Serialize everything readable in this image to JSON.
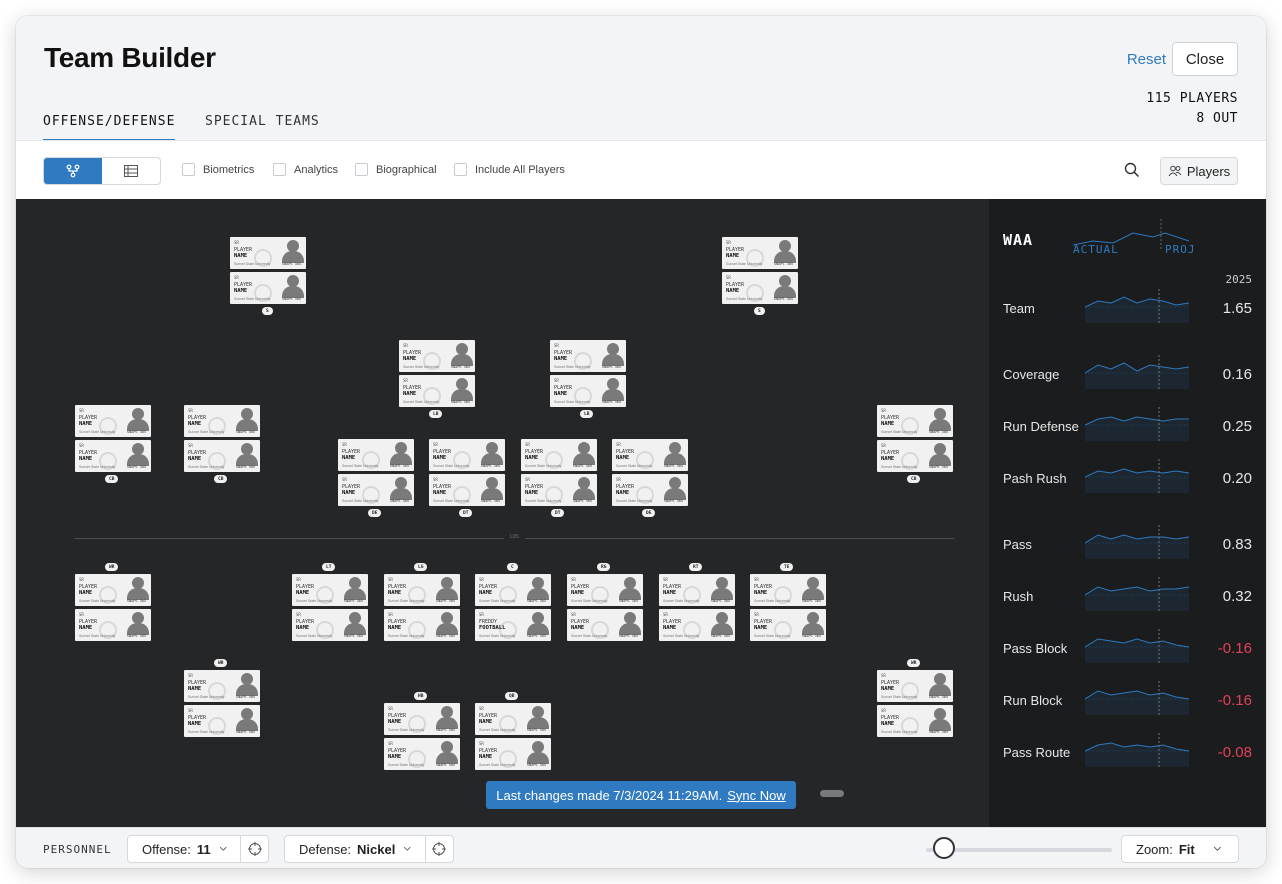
{
  "header": {
    "title": "Team Builder",
    "reset_label": "Reset",
    "close_label": "Close",
    "players_count": "115 PLAYERS",
    "out_count": "8 OUT"
  },
  "tabs": [
    {
      "label": "OFFENSE/DEFENSE",
      "active": true
    },
    {
      "label": "SPECIAL TEAMS",
      "active": false
    }
  ],
  "toolbar": {
    "view_modes": [
      "depth-chart-icon",
      "table-icon"
    ],
    "filters": [
      "Biometrics",
      "Analytics",
      "Biographical",
      "Include All Players"
    ],
    "players_button": "Players"
  },
  "card_template": {
    "position": "SR",
    "first_name": "PLAYER",
    "last_name": "NAME",
    "school": "Sunset State University",
    "snaps": "SNAPS 305"
  },
  "special_card": {
    "first_name": "FREDDY",
    "last_name": "FOOTBALL"
  },
  "field": {
    "los_label": "LOS",
    "position_labels": {
      "s1": "S",
      "s2": "S",
      "lb1": "LB",
      "lb2": "LB",
      "cb1": "CB",
      "cb2": "CB",
      "cb3": "CB",
      "de1": "DE",
      "dt1": "DT",
      "dt2": "DT",
      "de2": "DE",
      "wr1": "WR",
      "lt": "LT",
      "lg": "LG",
      "c": "C",
      "rg": "RG",
      "rt": "RT",
      "te": "TE",
      "wr2": "WR",
      "wr3": "WR",
      "hb": "HB",
      "qb": "QB"
    }
  },
  "toast": {
    "message": "Last changes made 7/3/2024 11:29AM.",
    "link": "Sync Now"
  },
  "waa": {
    "title": "WAA",
    "actual_label": "ACTUAL",
    "proj_label": "PROJ",
    "year": "2025",
    "metrics": [
      {
        "name": "Team",
        "value": "1.65",
        "negative": false
      },
      {
        "name": "Coverage",
        "value": "0.16",
        "negative": false
      },
      {
        "name": "Run Defense",
        "value": "0.25",
        "negative": false
      },
      {
        "name": "Pash Rush",
        "value": "0.20",
        "negative": false
      },
      {
        "name": "Pass",
        "value": "0.83",
        "negative": false
      },
      {
        "name": "Rush",
        "value": "0.32",
        "negative": false
      },
      {
        "name": "Pass Block",
        "value": "-0.16",
        "negative": true
      },
      {
        "name": "Run Block",
        "value": "-0.16",
        "negative": true
      },
      {
        "name": "Pass Route",
        "value": "-0.08",
        "negative": true
      }
    ]
  },
  "bottom": {
    "personnel_label": "PERSONNEL",
    "offense_label": "Offense:",
    "offense_value": "11",
    "defense_label": "Defense:",
    "defense_value": "Nickel",
    "zoom_label": "Zoom:",
    "zoom_value": "Fit",
    "zoom_level": 0.05
  },
  "colors": {
    "accent": "#2f7ac0",
    "negative": "#e0425a",
    "field_bg": "#242628",
    "panel_bg": "#1a1c1e"
  }
}
